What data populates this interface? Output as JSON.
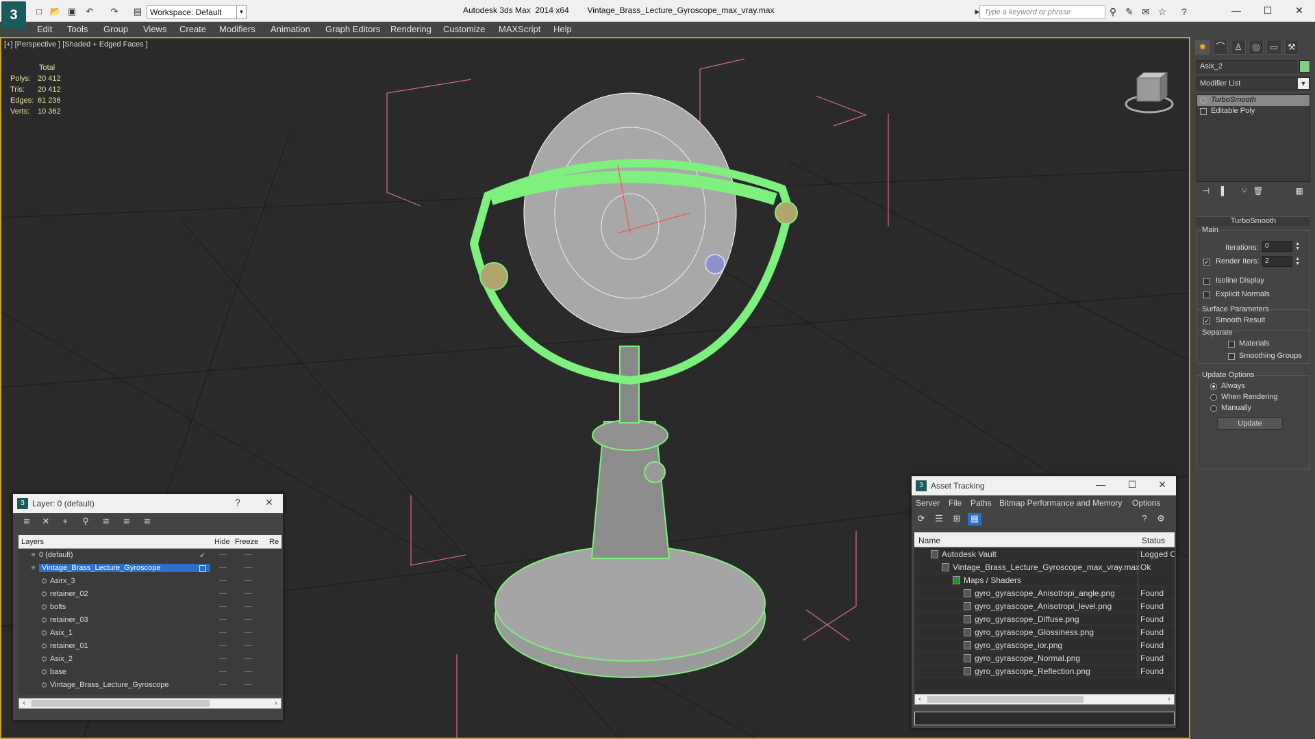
{
  "app": {
    "title": "Autodesk 3ds Max  2014 x64",
    "file": "Vintage_Brass_Lecture_Gyroscope_max_vray.max",
    "workspace": "Workspace: Default",
    "search_placeholder": "Type a keyword or phrase"
  },
  "menu": [
    "Edit",
    "Tools",
    "Group",
    "Views",
    "Create",
    "Modifiers",
    "Animation",
    "Graph Editors",
    "Rendering",
    "Customize",
    "MAXScript",
    "Help"
  ],
  "viewport": {
    "label": "[+] [Perspective ] [Shaded + Edged Faces ]",
    "stats": {
      "header": "Total",
      "rows": [
        {
          "k": "Polys:",
          "v": "20 412"
        },
        {
          "k": "Tris:",
          "v": "20 412"
        },
        {
          "k": "Edges:",
          "v": "61 236"
        },
        {
          "k": "Verts:",
          "v": "10 362"
        }
      ]
    }
  },
  "command_panel": {
    "object_name": "Asix_2",
    "modifier_list": "Modifier List",
    "stack": [
      "TurboSmooth",
      "Editable Poly"
    ],
    "rollout": "TurboSmooth",
    "main": {
      "title": "Main",
      "iterations_label": "Iterations:",
      "iterations": "0",
      "render_iters_label": "Render Iters:",
      "render_iters": "2",
      "isoline": "Isoline Display",
      "explicit": "Explicit Normals"
    },
    "surface": {
      "title": "Surface Parameters",
      "smooth": "Smooth Result",
      "separate": "Separate",
      "materials": "Materials",
      "smoothing": "Smoothing Groups"
    },
    "update": {
      "title": "Update Options",
      "always": "Always",
      "when_rendering": "When Rendering",
      "manually": "Manually",
      "button": "Update"
    }
  },
  "layer_window": {
    "title": "Layer: 0 (default)",
    "help": "?",
    "columns": {
      "layers": "Layers",
      "hide": "Hide",
      "freeze": "Freeze",
      "render": "Re"
    },
    "rows": [
      {
        "name": "0 (default)",
        "indent": 0,
        "kind": "layer",
        "check": "✓"
      },
      {
        "name": "Vintage_Brass_Lecture_Gyroscope",
        "indent": 0,
        "kind": "layer",
        "selected": true
      },
      {
        "name": "Asirx_3",
        "indent": 1,
        "kind": "object"
      },
      {
        "name": "retainer_02",
        "indent": 1,
        "kind": "object"
      },
      {
        "name": "bolts",
        "indent": 1,
        "kind": "object"
      },
      {
        "name": "retainer_03",
        "indent": 1,
        "kind": "object"
      },
      {
        "name": "Asix_1",
        "indent": 1,
        "kind": "object"
      },
      {
        "name": "retainer_01",
        "indent": 1,
        "kind": "object"
      },
      {
        "name": "Asix_2",
        "indent": 1,
        "kind": "object"
      },
      {
        "name": "base",
        "indent": 1,
        "kind": "object"
      },
      {
        "name": "Vintage_Brass_Lecture_Gyroscope",
        "indent": 1,
        "kind": "object"
      }
    ]
  },
  "asset_window": {
    "title": "Asset Tracking",
    "menu": [
      "Server",
      "File",
      "Paths",
      "Bitmap Performance and Memory",
      "Options"
    ],
    "columns": {
      "name": "Name",
      "status": "Status"
    },
    "rows": [
      {
        "name": "Autodesk Vault",
        "status": "Logged Out",
        "indent": 0
      },
      {
        "name": "Vintage_Brass_Lecture_Gyroscope_max_vray.max",
        "status": "Ok",
        "indent": 1
      },
      {
        "name": "Maps / Shaders",
        "status": "",
        "indent": 2
      },
      {
        "name": "gyro_gyrascope_Anisotropi_angle.png",
        "status": "Found",
        "indent": 3
      },
      {
        "name": "gyro_gyrascope_Anisotropi_level.png",
        "status": "Found",
        "indent": 3
      },
      {
        "name": "gyro_gyrascope_Diffuse.png",
        "status": "Found",
        "indent": 3
      },
      {
        "name": "gyro_gyrascope_Glossiness.png",
        "status": "Found",
        "indent": 3
      },
      {
        "name": "gyro_gyrascope_ior.png",
        "status": "Found",
        "indent": 3
      },
      {
        "name": "gyro_gyrascope_Normal.png",
        "status": "Found",
        "indent": 3
      },
      {
        "name": "gyro_gyrascope_Reflection.png",
        "status": "Found",
        "indent": 3
      }
    ]
  },
  "colors": {
    "wire": "#7df07d",
    "selection": "#2a6fc9",
    "viewport_border": "#c8a030"
  }
}
